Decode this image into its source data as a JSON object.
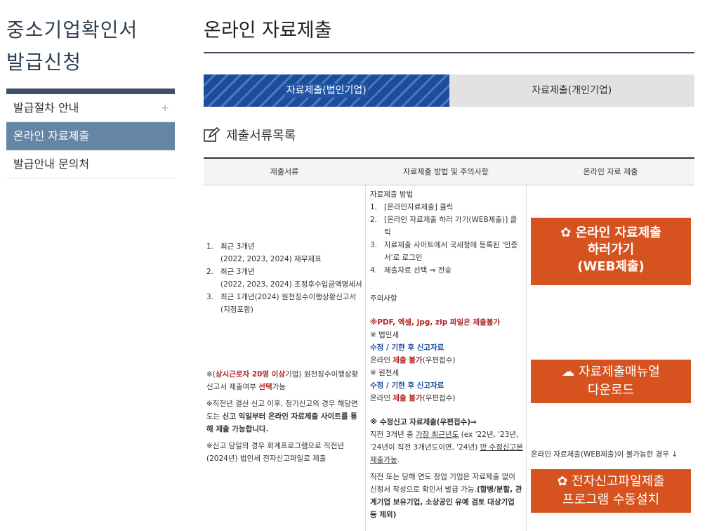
{
  "sidebar": {
    "title_line1": "중소기업확인서",
    "title_line2": "발급신청",
    "items": [
      {
        "label": "발급절차 안내",
        "plus": "+"
      },
      {
        "label": "온라인 자료제출"
      },
      {
        "label": "발급안내 문의처"
      }
    ]
  },
  "main": {
    "title": "온라인 자료제출",
    "tabs": [
      {
        "label": "자료제출(법인기업)",
        "active": true
      },
      {
        "label": "자료제출(개인기업)",
        "active": false
      }
    ],
    "section_title": "제출서류목록"
  },
  "table": {
    "headers": [
      "제출서류",
      "자료제출 방법 및 주의사항",
      "온라인 자료 제출"
    ],
    "docs": [
      {
        "num": "1.",
        "line1": "최근 3개년",
        "line2": "(2022, 2023, 2024) 재무제표"
      },
      {
        "num": "2.",
        "line1": "최근 3개년",
        "line2": "(2022, 2023, 2024) 조정후수입금액명세서"
      },
      {
        "num": "3.",
        "line1": "최근 1개년(2024) 원천징수이행상황신고서",
        "line2": "(지점포함)"
      }
    ],
    "notes": {
      "n1_a": "※(",
      "n1_red": "상시근로자 20명 이상",
      "n1_b": "기업) 원천징수이행상황신고서 제출여부 ",
      "n1_red2": "선택",
      "n1_c": "가능",
      "n2_a": "※직전년 결산 신고 이후, 정기신고의 경우 해당연도는 ",
      "n2_b": "신고 익일부터 온라인 자료제출 사이트를 통해 제출 가능합니다.",
      "n3": "※신고 당일의 경우 회계프로그램으로 직전년(2024년) 법인세 전자신고파일로 제출"
    },
    "procedure": {
      "title": "자료제출 방법",
      "steps": [
        {
          "num": "1.",
          "text": "[온라인자료제출] 클릭"
        },
        {
          "num": "2.",
          "text": "[온라인 자료제출 하러 가기(WEB제출)] 클릭"
        },
        {
          "num": "3.",
          "text": "자료제출 사이트에서 국세청에 등록된 '인증서'로 로그인"
        },
        {
          "num": "4.",
          "text": "제출자료 선택 ⇒ 전송"
        }
      ],
      "caution_title": "주의사항",
      "caution_red": "※PDF, 엑셀, jpg, zip 파일은 ",
      "caution_red_b": "제출불가",
      "corp_tax": "※ 법인세",
      "corp_tax_blue": "수정 / 기한 후 신고자료",
      "corp_tax_line_a": "온라인 ",
      "corp_tax_line_red": "제출 불가",
      "corp_tax_line_b": "(우편접수)",
      "withhold": "※ 원천세",
      "withhold_blue": "수정 / 기한 후 신고자료",
      "withhold_line_a": "온라인 ",
      "withhold_line_red": "제출 불가",
      "withhold_line_b": "(우편접수)",
      "amend_title": "※ 수정신고 자료제출(우편접수)⇒",
      "amend_a": "직전 3개년 중 ",
      "amend_u1": "가장 최근년도",
      "amend_b": " (ex '22년, '23년, '24년이 직전 3개년도이면, '24년) ",
      "amend_u2": "만 수정신고본 제출가능",
      "amend_c": ".",
      "startup_a": "직전 또는 당해 연도 창업 기업은 자료제출 없이 신청서 작성으로 확인서 발급 가능.",
      "startup_b": "(합병/분할, 관계기업 보유기업, 소상공인 유예 검토 대상기업 등 제외)"
    },
    "buttons": {
      "web_line1": "온라인 자료제출",
      "web_line2": "하러가기",
      "web_line3": "(WEB제출)",
      "manual_line1": "자료제출매뉴얼",
      "manual_line2": "다운로드",
      "fallback_note": "온라인 자료제출(WEB제출)이 불가능한 경우 ↓",
      "install_line1": "전자신고파일제출",
      "install_line2": "프로그램 수동설치"
    }
  }
}
